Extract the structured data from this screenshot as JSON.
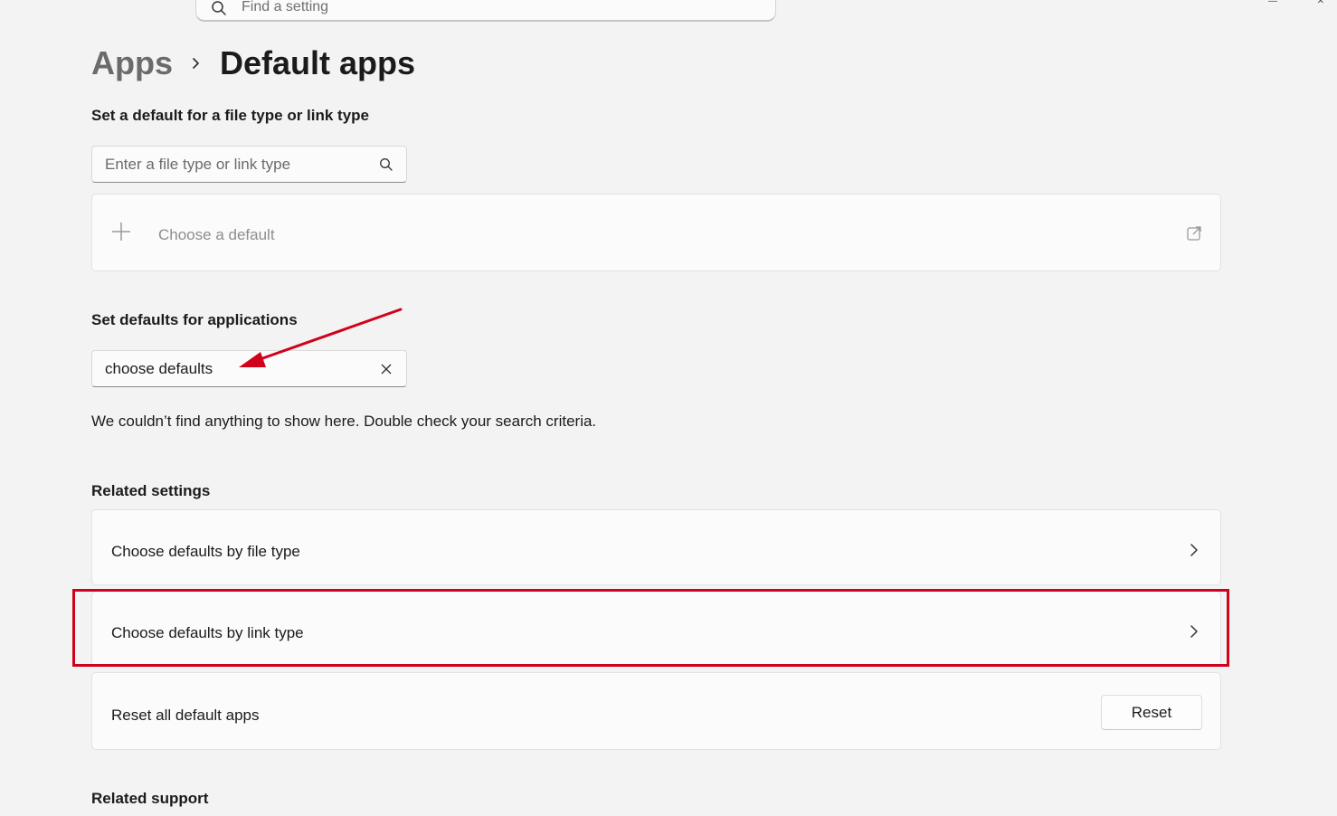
{
  "top_search": {
    "placeholder": "Find a setting"
  },
  "breadcrumb": {
    "parent": "Apps",
    "current": "Default apps"
  },
  "file_type_section": {
    "title": "Set a default for a file type or link type",
    "search_placeholder": "Enter a file type or link type",
    "choose_default_label": "Choose a default"
  },
  "app_section": {
    "title": "Set defaults for applications",
    "search_value": "choose defaults",
    "empty_message": "We couldn’t find anything to show here. Double check your search criteria."
  },
  "related_settings": {
    "title": "Related settings",
    "items": [
      {
        "label": "Choose defaults by file type"
      },
      {
        "label": "Choose defaults by link type"
      }
    ],
    "reset_row": {
      "label": "Reset all default apps",
      "button": "Reset"
    }
  },
  "related_support": {
    "title": "Related support"
  },
  "annotation": {
    "highlight_color": "#d0021b"
  }
}
